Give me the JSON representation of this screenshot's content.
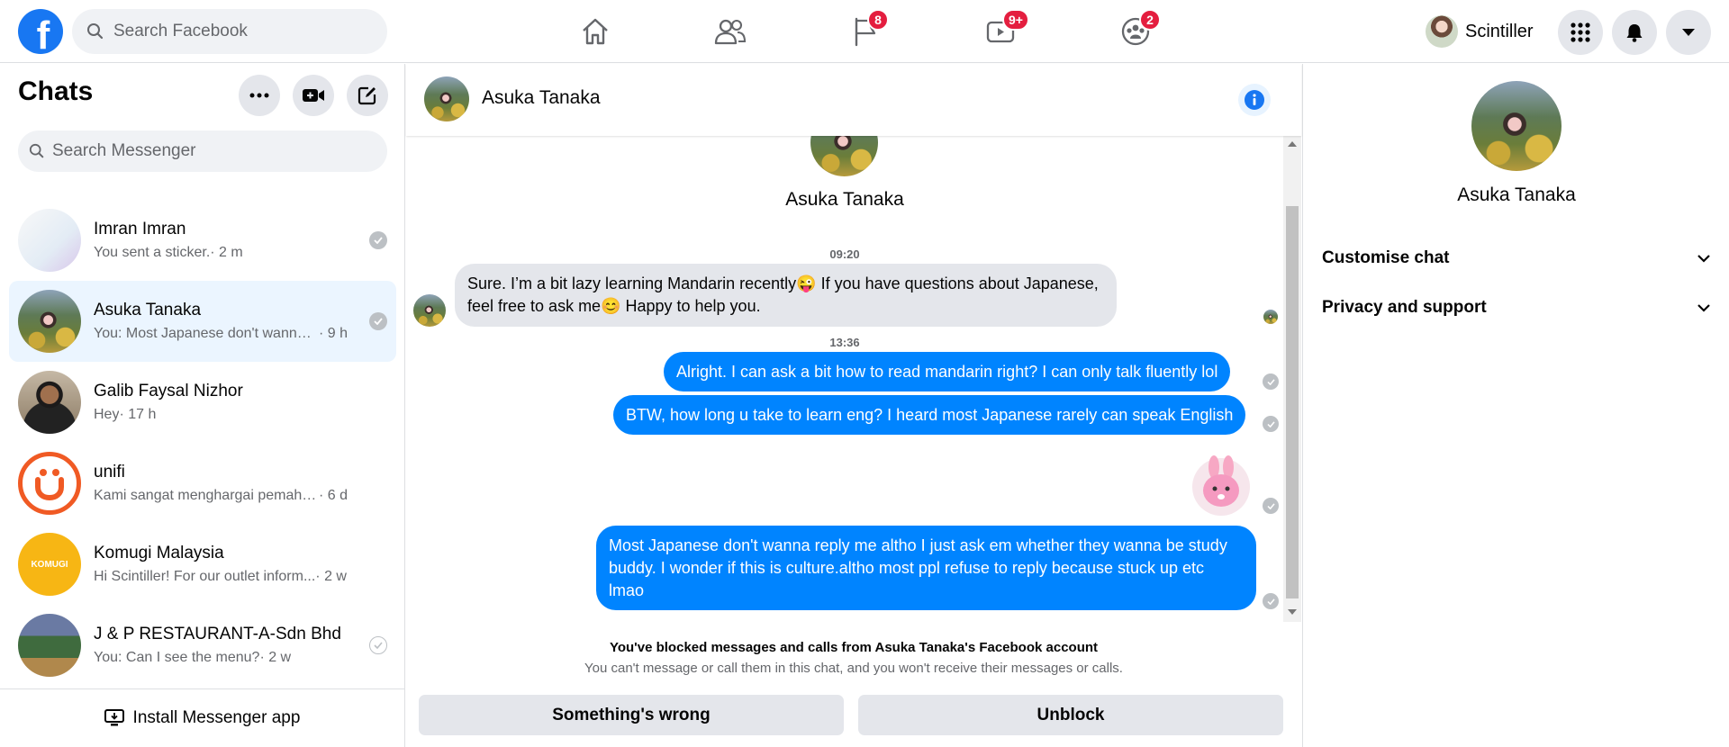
{
  "topbar": {
    "search_placeholder": "Search Facebook",
    "nav": [
      {
        "name": "home",
        "badge": ""
      },
      {
        "name": "friends",
        "badge": ""
      },
      {
        "name": "pages",
        "badge": "8"
      },
      {
        "name": "watch",
        "badge": "9+"
      },
      {
        "name": "groups",
        "badge": "2"
      }
    ],
    "profile_name": "Scintiller",
    "accent": "#1877f2",
    "badge_color": "#e41e3f"
  },
  "left": {
    "title": "Chats",
    "search_placeholder": "Search Messenger",
    "chats": [
      {
        "name": "Imran Imran",
        "preview": "You sent a sticker.",
        "time": " · 2 m",
        "status": "seen"
      },
      {
        "name": "Asuka Tanaka",
        "preview": "You: Most Japanese don't wanna ...",
        "time": " · 9 h",
        "status": "seen"
      },
      {
        "name": "Galib Faysal Nizhor",
        "preview": "Hey",
        "time": " · 17 h",
        "status": ""
      },
      {
        "name": "unifi",
        "preview": "Kami sangat menghargai pemaha...",
        "time": " · 6 d",
        "status": ""
      },
      {
        "name": "Komugi Malaysia",
        "preview": "Hi Scintiller! For our outlet inform...",
        "time": " · 2 w",
        "status": ""
      },
      {
        "name": "J & P RESTAURANT-A-Sdn Bhd",
        "preview": "You: Can I see the menu?",
        "time": " · 2 w",
        "status": "sent"
      }
    ],
    "komugi_logo_text": "KOMUGI",
    "install_label": "Install Messenger app"
  },
  "conversation": {
    "name": "Asuka Tanaka",
    "timestamps": [
      "09:20",
      "13:36"
    ],
    "messages": [
      {
        "dir": "in",
        "text": "Sure. I’m a bit lazy learning Mandarin recently😜 If you have questions about Japanese, feel free to ask me😊 Happy to help you."
      },
      {
        "dir": "out",
        "text": "Alright. I can ask a bit how to read mandarin right? I can only talk fluently lol"
      },
      {
        "dir": "out",
        "text": "BTW, how long u take to learn eng? I heard most Japanese rarely can speak English"
      },
      {
        "dir": "out",
        "text": "Most Japanese don't wanna reply me altho I just ask em whether they wanna be study buddy. I wonder if this is culture.altho most ppl refuse  to reply because stuck up etc lmao"
      }
    ],
    "blocked_title": "You've blocked messages and calls from Asuka Tanaka's Facebook account",
    "blocked_sub": "You can't message or call them in this chat, and you won't receive their messages or calls.",
    "btn_wrong": "Something's wrong",
    "btn_unblock": "Unblock",
    "bubble_out_color": "#0084ff"
  },
  "right_panel": {
    "name": "Asuka Tanaka",
    "rows": [
      "Customise chat",
      "Privacy and support"
    ]
  }
}
